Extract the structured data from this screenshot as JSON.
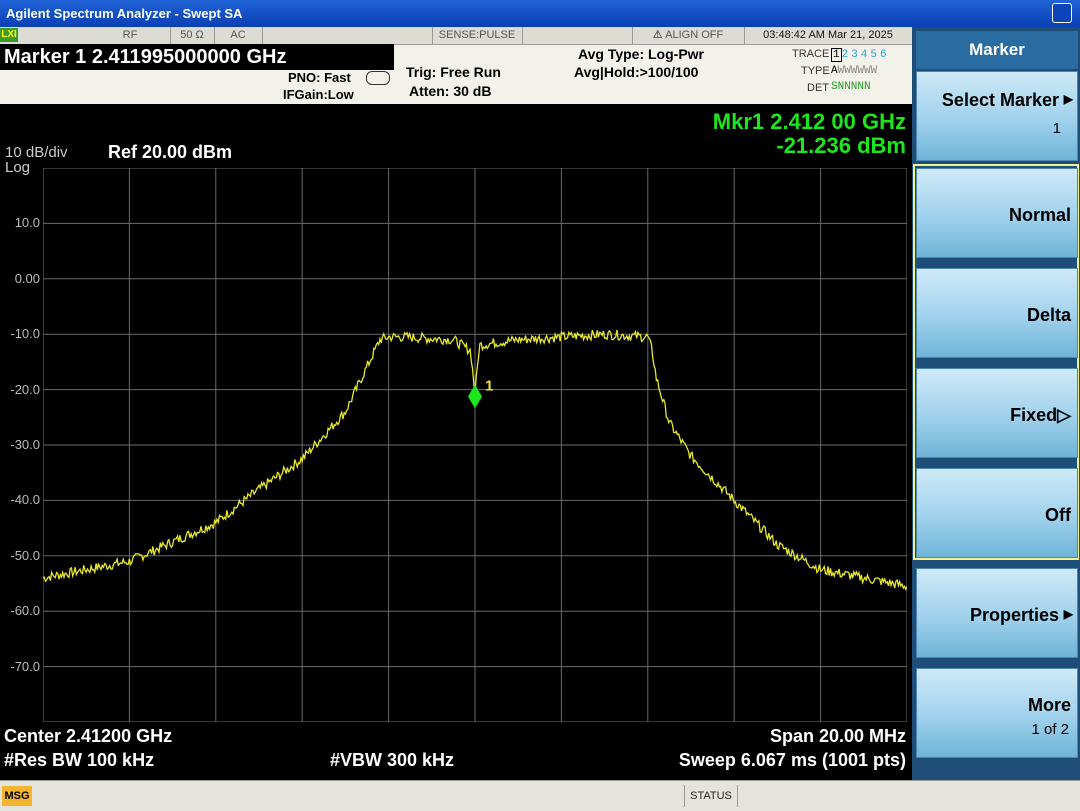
{
  "window": {
    "title": "Agilent Spectrum Analyzer - Swept SA"
  },
  "status_strip": {
    "lxi": "LXI",
    "rf": "RF",
    "impedance": "50 Ω",
    "coupling": "AC",
    "sense": "SENSE:PULSE",
    "align": "ALIGN OFF",
    "datetime": "03:48:42 AM Mar 21, 2025"
  },
  "settings": {
    "marker_title": "Marker 1  2.411995000000 GHz",
    "pno": "PNO: Fast",
    "ifgain": "IFGain:Low",
    "trig": "Trig: Free Run",
    "atten": "Atten: 30 dB",
    "avg_type": "Avg Type: Log-Pwr",
    "avg_hold": "Avg|Hold:>100/100",
    "trace_label": "TRACE",
    "trace_nums": "123456",
    "type_label": "TYPE",
    "type_val": "A",
    "det_label": "DET",
    "det_val": "SNNNNN"
  },
  "plot": {
    "scale_div": "10 dB/div",
    "scale_type": "Log",
    "ref_level": "Ref 20.00 dBm",
    "marker_readout_freq": "Mkr1 2.412 00 GHz",
    "marker_readout_amp": "-21.236 dBm",
    "marker_label": "1",
    "y_ticks": [
      "10.0",
      "0.00",
      "-10.0",
      "-20.0",
      "-30.0",
      "-40.0",
      "-50.0",
      "-60.0",
      "-70.0"
    ],
    "center": "Center 2.41200 GHz",
    "span": "Span 20.00 MHz",
    "rbw": "#Res BW 100 kHz",
    "vbw": "#VBW 300 kHz",
    "sweep": "Sweep  6.067 ms (1001 pts)",
    "colors": {
      "trace": "#e8e82a",
      "grid": "#6b6b6b",
      "marker": "#1ee61e"
    }
  },
  "chart_data": {
    "type": "line",
    "xlabel": "",
    "ylabel": "",
    "x_unit": "MHz offset from center",
    "ylim": [
      -80,
      20
    ],
    "xlim": [
      -10,
      10
    ],
    "series": [
      {
        "values_x": [
          -10,
          -9,
          -8,
          -7,
          -6,
          -5,
          -4,
          -3,
          -2.2,
          -2,
          -1.6,
          -1,
          -0.5,
          -0.1,
          0,
          0.1,
          0.5,
          1,
          2,
          3,
          4,
          4.1,
          4.2,
          4.5,
          5,
          6,
          7,
          8,
          9,
          10
        ],
        "values_y": [
          -54,
          -52.5,
          -51,
          -47.5,
          -44,
          -38,
          -32.5,
          -24,
          -11,
          -10.5,
          -10.5,
          -10.8,
          -11,
          -13,
          -21,
          -12,
          -11.5,
          -11,
          -10.5,
          -10,
          -10.5,
          -13,
          -18,
          -26,
          -32,
          -40,
          -48,
          -52.5,
          -54,
          -55.5
        ]
      }
    ],
    "marker": {
      "x": 0,
      "y": -21.236
    }
  },
  "softkeys": {
    "menu_title": "Marker",
    "select_marker": "Select Marker",
    "select_marker_val": "1",
    "normal": "Normal",
    "delta": "Delta",
    "fixed": "Fixed▷",
    "off": "Off",
    "properties": "Properties",
    "more": "More",
    "more_page": "1 of 2"
  },
  "bottom": {
    "msg": "MSG",
    "status": "STATUS"
  }
}
